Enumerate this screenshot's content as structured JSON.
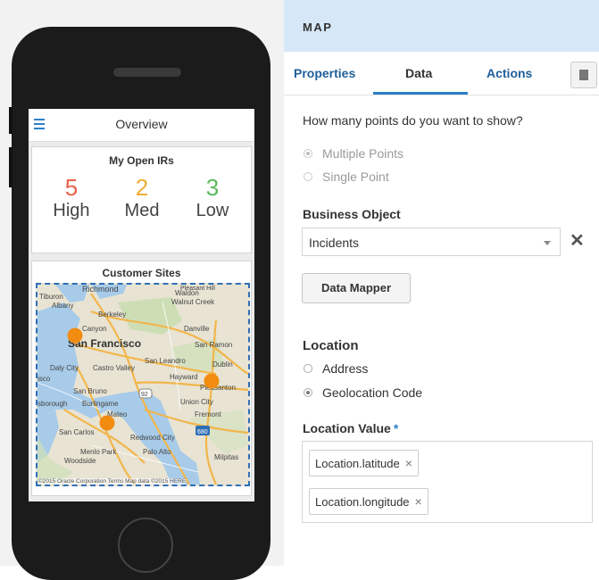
{
  "phone_app": {
    "title": "Overview",
    "irs_card": {
      "title": "My Open IRs",
      "stats": [
        {
          "value": "5",
          "label": "High",
          "color": "#e8614a"
        },
        {
          "value": "2",
          "label": "Med",
          "color": "#f0ad34"
        },
        {
          "value": "3",
          "label": "Low",
          "color": "#5cb85c"
        }
      ]
    },
    "sites_card": {
      "title": "Customer Sites",
      "map_labels": [
        "Richmond",
        "Pleasant Hill",
        "Walnut Creek",
        "Tiburon",
        "Albany",
        "Berkeley",
        "Canyon",
        "Danville",
        "San Francisco",
        "San Ramon",
        "San Leandro",
        "Dublin",
        "Daly City",
        "Castro Valley",
        "Hayward",
        "Pleasanton",
        "San Bruno",
        "Union City",
        "Burlingame",
        "Mateo",
        "Fremont",
        "San Carlos",
        "Redwood City",
        "Menlo Park",
        "Palo Alto",
        "Woodside",
        "Milpitas",
        "Waldon",
        "isco",
        "sborough",
        "680",
        "92"
      ],
      "credit": "©2015 Oracle Corporation  Terms  Map data ©2015 HERE",
      "marker_color": "#f28c10"
    }
  },
  "panel": {
    "title": "MAP",
    "tabs": [
      "Properties",
      "Data",
      "Actions"
    ],
    "active_tab": "Data",
    "question": "How many points do you want to show?",
    "points_options": [
      {
        "label": "Multiple Points",
        "selected": true
      },
      {
        "label": "Single Point",
        "selected": false
      }
    ],
    "business_object_label": "Business Object",
    "business_object_value": "Incidents",
    "data_mapper_label": "Data Mapper",
    "location_label": "Location",
    "location_options": [
      {
        "label": "Address",
        "selected": false
      },
      {
        "label": "Geolocation Code",
        "selected": true
      }
    ],
    "location_value_label": "Location Value",
    "required_mark": "*",
    "location_values": [
      "Location.latitude",
      "Location.longitude"
    ],
    "token_remove": "×",
    "clear_icon": "✕"
  },
  "colors": {
    "accent": "#2a7fc7",
    "panel_header": "#d6e8f8"
  }
}
